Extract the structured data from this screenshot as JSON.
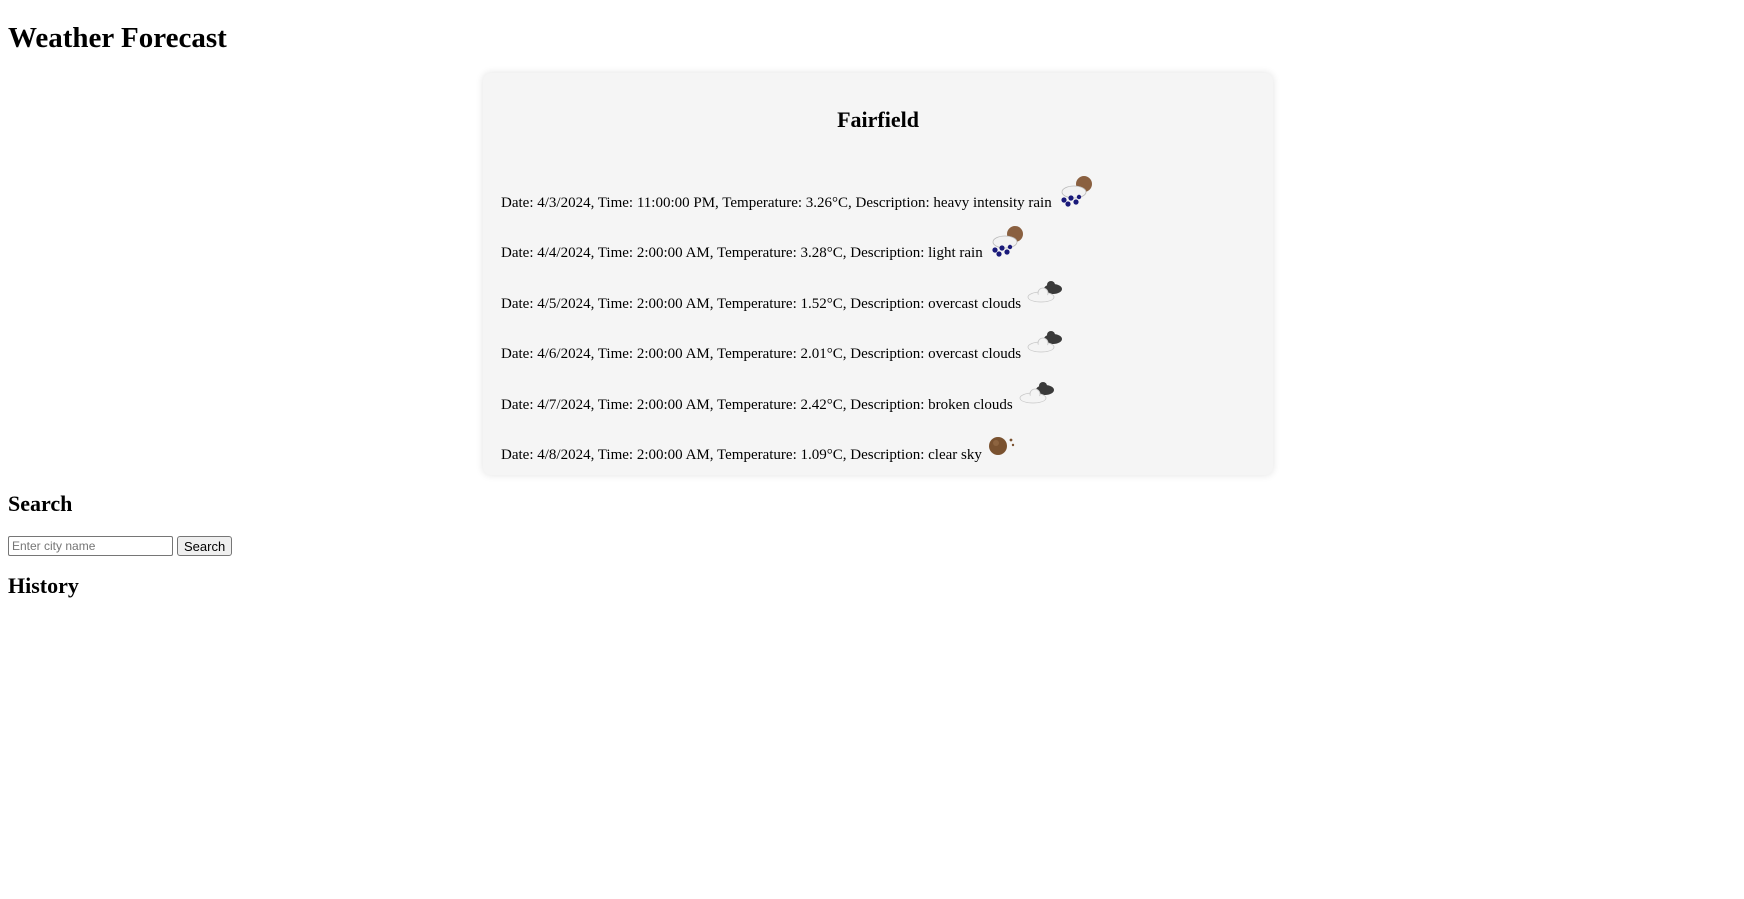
{
  "page": {
    "title": "Weather Forecast"
  },
  "forecast": {
    "city": "Fairfield",
    "items": [
      {
        "text": "Date: 4/3/2024, Time: 11:00:00 PM, Temperature: 3.26°C, Description: heavy intensity rain",
        "icon": "rain-icon"
      },
      {
        "text": "Date: 4/4/2024, Time: 2:00:00 AM, Temperature: 3.28°C, Description: light rain",
        "icon": "rain-icon"
      },
      {
        "text": "Date: 4/5/2024, Time: 2:00:00 AM, Temperature: 1.52°C, Description: overcast clouds",
        "icon": "clouds-icon"
      },
      {
        "text": "Date: 4/6/2024, Time: 2:00:00 AM, Temperature: 2.01°C, Description: overcast clouds",
        "icon": "clouds-icon"
      },
      {
        "text": "Date: 4/7/2024, Time: 2:00:00 AM, Temperature: 2.42°C, Description: broken clouds",
        "icon": "clouds-icon"
      },
      {
        "text": "Date: 4/8/2024, Time: 2:00:00 AM, Temperature: 1.09°C, Description: clear sky",
        "icon": "clear-night-icon"
      }
    ]
  },
  "search": {
    "heading": "Search",
    "placeholder": "Enter city name",
    "button_label": "Search"
  },
  "history": {
    "heading": "History"
  },
  "colors": {
    "card_background": "#f5f5f5",
    "rain_drops": "#1a1a7a",
    "moon": "#7a5230"
  }
}
